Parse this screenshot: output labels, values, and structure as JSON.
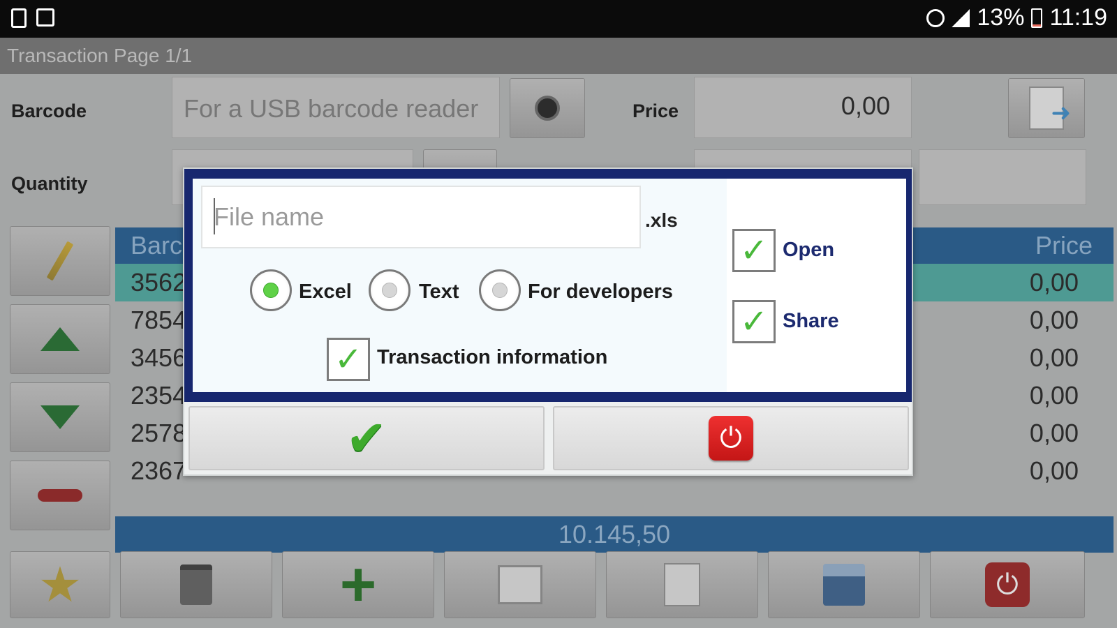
{
  "statusbar": {
    "battery": "13%",
    "time": "11:19"
  },
  "app": {
    "title": "Transaction Page 1/1",
    "barcode_label": "Barcode",
    "barcode_placeholder": "For a USB barcode reader",
    "price_label": "Price",
    "price_value": "0,00",
    "quantity_label": "Quantity",
    "table": {
      "col_barcode": "Barc",
      "col_price": "Price",
      "rows": [
        {
          "barcode": "3562",
          "price": "0,00"
        },
        {
          "barcode": "7854",
          "price": "0,00"
        },
        {
          "barcode": "3456",
          "price": "0,00"
        },
        {
          "barcode": "2354",
          "price": "0,00"
        },
        {
          "barcode": "2578",
          "price": "0,00"
        },
        {
          "barcode": "2367",
          "price": "0,00"
        }
      ]
    },
    "total": "10.145,50"
  },
  "dialog": {
    "file_name_placeholder": "File name",
    "extension": ".xls",
    "formats": {
      "excel": "Excel",
      "text": "Text",
      "developers": "For developers",
      "selected": "Excel"
    },
    "transaction_info": "Transaction information",
    "open": "Open",
    "share": "Share",
    "ok_icon": "check-icon",
    "cancel_icon": "power-icon"
  },
  "colors": {
    "accent": "#17276f",
    "check": "#49b83a",
    "danger": "#d61f1f"
  }
}
